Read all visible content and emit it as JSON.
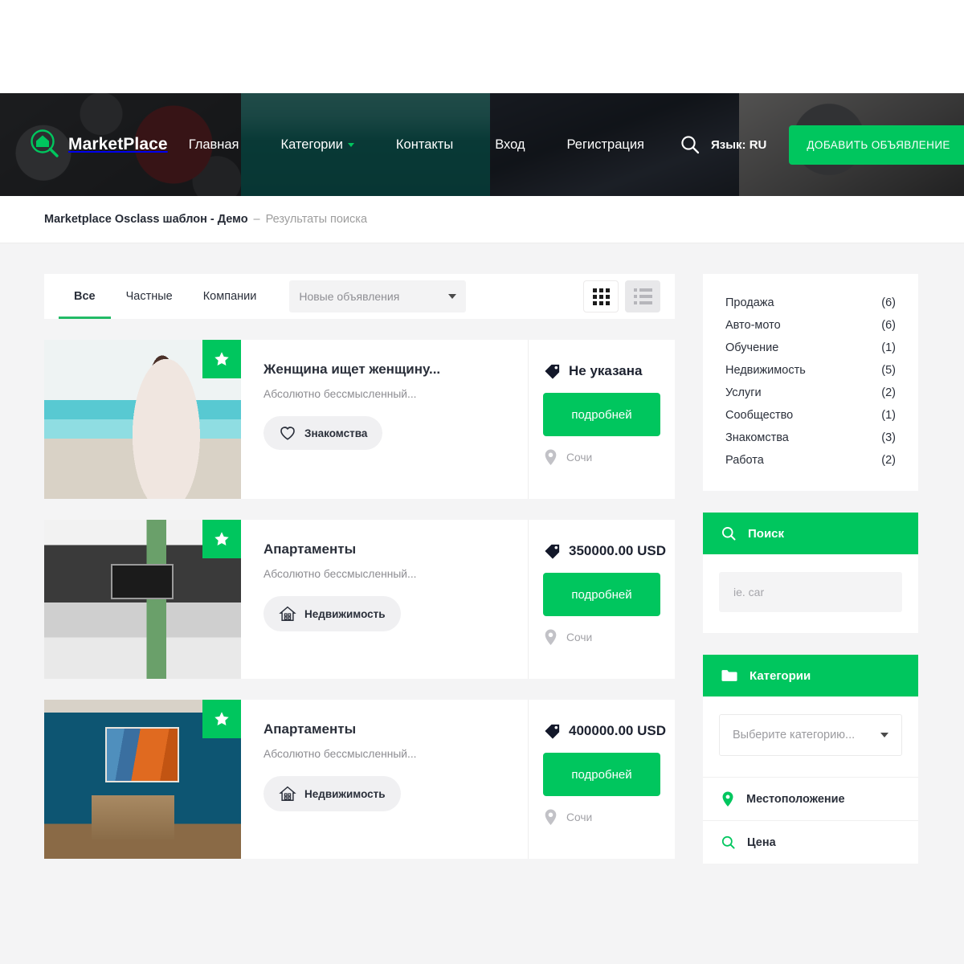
{
  "brand": {
    "name": "MarketPlace",
    "logo_icon": "house-magnifier-icon"
  },
  "header": {
    "nav": [
      {
        "label": "Главная",
        "icon": null
      },
      {
        "label": "Категории",
        "icon": "chevron-down-icon"
      },
      {
        "label": "Контакты",
        "icon": null
      },
      {
        "label": "Вход",
        "icon": null
      },
      {
        "label": "Регистрация",
        "icon": null
      }
    ],
    "search_icon": "search-icon",
    "language": "Язык: RU",
    "add_listing_label": "ДОБАВИТЬ ОБЪЯВЛЕНИЕ",
    "accent_color": "#00c65e"
  },
  "breadcrumb": {
    "root": "Marketplace Osclass шаблон - Демо",
    "separator": "–",
    "current": "Результаты поиска"
  },
  "toolbar": {
    "tabs": [
      {
        "label": "Все",
        "active": true
      },
      {
        "label": "Частные",
        "active": false
      },
      {
        "label": "Компании",
        "active": false
      }
    ],
    "sort": {
      "value": "Новые объявления",
      "caret": "chevron-down-icon"
    },
    "views": [
      {
        "name": "grid-view",
        "icon": "grid-icon",
        "active": true
      },
      {
        "name": "list-view",
        "icon": "list-icon",
        "active": false
      }
    ]
  },
  "listings": [
    {
      "title": "Женщина ищет женщину...",
      "description": "Абсолютно бессмысленный...",
      "category": "Знакомства",
      "category_icon": "heart-icon",
      "price": "Не указана",
      "price_icon": "price-tag-icon",
      "cta": "подробней",
      "location": "Сочи",
      "location_icon": "map-pin-icon",
      "featured_icon": "star-icon",
      "photo": "beach"
    },
    {
      "title": "Апартаменты",
      "description": "Абсолютно бессмысленный...",
      "category": "Недвижимость",
      "category_icon": "house-icon",
      "price": "350000.00 USD",
      "price_icon": "price-tag-icon",
      "cta": "подробней",
      "location": "Сочи",
      "location_icon": "map-pin-icon",
      "featured_icon": "star-icon",
      "photo": "gray-living-room"
    },
    {
      "title": "Апартаменты",
      "description": "Абсолютно бессмысленный...",
      "category": "Недвижимость",
      "category_icon": "house-icon",
      "price": "400000.00 USD",
      "price_icon": "price-tag-icon",
      "cta": "подробней",
      "location": "Сочи",
      "location_icon": "map-pin-icon",
      "featured_icon": "star-icon",
      "photo": "blue-room"
    }
  ],
  "sidebar": {
    "categories": [
      {
        "name": "Продажа",
        "count": "(6)"
      },
      {
        "name": "Авто-мото",
        "count": "(6)"
      },
      {
        "name": "Обучение",
        "count": "(1)"
      },
      {
        "name": "Недвижимость",
        "count": "(5)"
      },
      {
        "name": "Услуги",
        "count": "(2)"
      },
      {
        "name": "Сообщество",
        "count": "(1)"
      },
      {
        "name": "Знакомства",
        "count": "(3)"
      },
      {
        "name": "Работа",
        "count": "(2)"
      }
    ],
    "search_widget": {
      "title": "Поиск",
      "icon": "search-icon",
      "input_placeholder": "ie. car"
    },
    "category_widget": {
      "title": "Категории",
      "icon": "folder-icon",
      "select_value": "Выберите категорию...",
      "caret": "chevron-down-icon"
    },
    "accordions": [
      {
        "label": "Местоположение",
        "icon": "map-pin-icon"
      },
      {
        "label": "Цена",
        "icon": "search-icon"
      }
    ]
  }
}
